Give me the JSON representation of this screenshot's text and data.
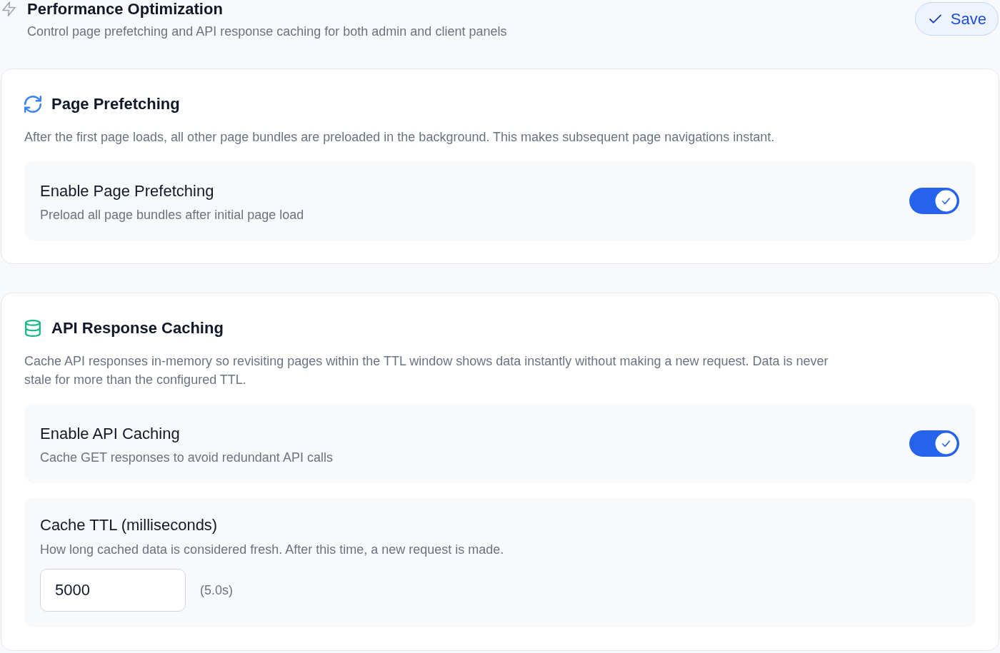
{
  "header": {
    "title": "Performance Optimization",
    "subtitle": "Control page prefetching and API response caching for both admin and client panels",
    "save_button": "Save"
  },
  "sections": [
    {
      "title": "Page Prefetching",
      "description": "After the first page loads, all other page bundles are preloaded in the background. This makes subsequent page navigations instant.",
      "settings": [
        {
          "kind": "toggle",
          "label": "Enable Page Prefetching",
          "description": "Preload all page bundles after initial page load",
          "on": true
        }
      ]
    },
    {
      "title": "API Response Caching",
      "description": "Cache API responses in-memory so revisiting pages within the TTL window shows data instantly without making a new request. Data is never stale for more than the configured TTL.",
      "settings": [
        {
          "kind": "toggle",
          "label": "Enable API Caching",
          "description": "Cache GET responses to avoid redundant API calls",
          "on": true
        },
        {
          "kind": "number",
          "label": "Cache TTL (milliseconds)",
          "description": "How long cached data is considered fresh. After this time, a new request is made.",
          "value": "5000",
          "hint": "(5.0s)"
        }
      ]
    }
  ]
}
